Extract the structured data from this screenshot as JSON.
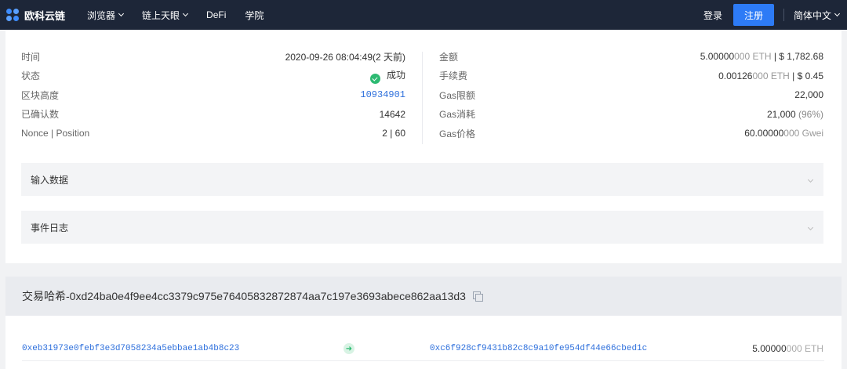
{
  "nav": {
    "brand": "欧科云链",
    "items": [
      {
        "label": "浏览器",
        "dropdown": true
      },
      {
        "label": "链上天眼",
        "dropdown": true
      },
      {
        "label": "DeFi",
        "dropdown": false
      },
      {
        "label": "学院",
        "dropdown": false
      }
    ],
    "login": "登录",
    "register": "注册",
    "language": "简体中文"
  },
  "detail": {
    "left": [
      {
        "key": "时间",
        "value": "2020-09-26 08:04:49(2 天前)"
      },
      {
        "key": "状态",
        "value": "成功"
      },
      {
        "key": "区块高度",
        "value": "10934901"
      },
      {
        "key": "已确认数",
        "value": "14642"
      },
      {
        "key": "Nonce | Position",
        "value": "2 | 60"
      }
    ],
    "right": [
      {
        "key": "金额",
        "value_main": "5.00000",
        "value_muted": "000 ETH",
        "value_rest": " | $ 1,782.68"
      },
      {
        "key": "手续费",
        "value_main": "0.00126",
        "value_muted": "000 ETH",
        "value_rest": " | $ 0.45"
      },
      {
        "key": "Gas限额",
        "value": "22,000"
      },
      {
        "key": "Gas消耗",
        "value_main": "21,000",
        "value_muted": " (96%)"
      },
      {
        "key": "Gas价格",
        "value_main": "60.00000",
        "value_muted": "000 Gwei"
      }
    ]
  },
  "sections": {
    "input_data": "输入数据",
    "event_log": "事件日志"
  },
  "hash": {
    "title": "交易哈希-0xd24ba0e4f9ee4cc3379c975e76405832872874aa7c197e3693abece862aa13d3"
  },
  "transfer": {
    "from": "0xeb31973e0febf3e3d7058234a5ebbae1ab4b8c23",
    "to": "0xc6f928cf9431b82c8c9a10fe954df44e66cbed1c",
    "value_main": "5.00000",
    "value_muted": "000 ETH"
  },
  "colors": {
    "nav_bg": "#1d2638",
    "accent": "#2d7bf6",
    "success": "#2dba72",
    "link": "#2d6fdc"
  }
}
